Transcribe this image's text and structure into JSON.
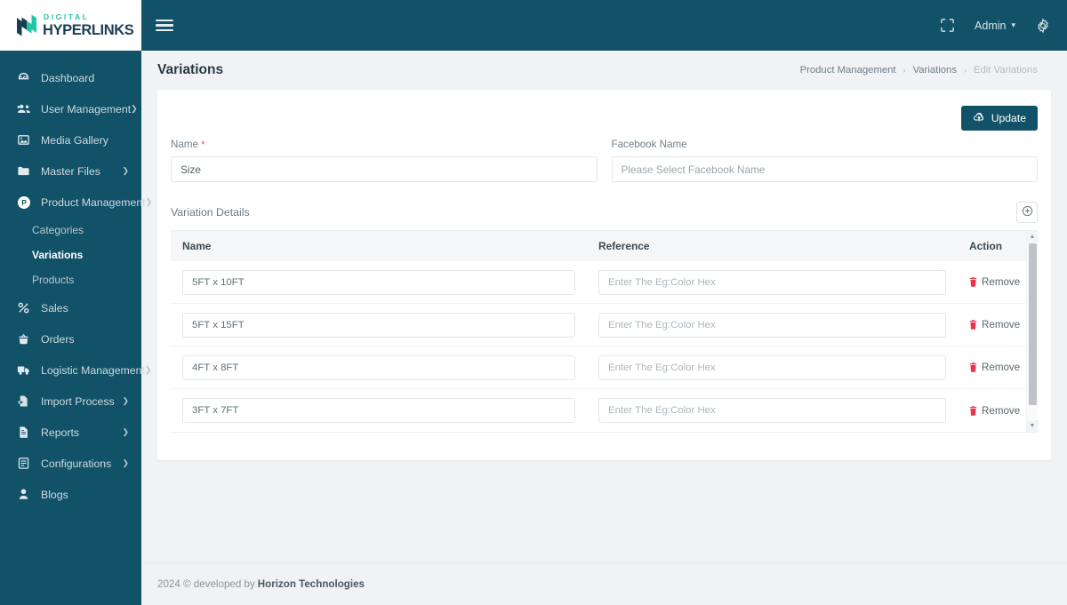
{
  "brand": {
    "top_text": "DIGITAL",
    "bottom_text": "HYPERLINKS",
    "accent": "#20c6a4",
    "dark": "#1b3f52"
  },
  "theme": {
    "sidebar_bg": "#115268",
    "topbar_bg": "#115268",
    "page_bg": "#f0f2f5",
    "primary": "#115268",
    "danger": "#e8344e",
    "required": "#f0536a"
  },
  "topbar": {
    "menu_toggle": "hamburger-menu",
    "fullscreen_label": "fullscreen-icon",
    "admin_label": "Admin",
    "settings_label": "gear-icon"
  },
  "sidebar": {
    "items": [
      {
        "label": "Dashboard",
        "icon": "dashboard-icon",
        "has_caret": false
      },
      {
        "label": "User Management",
        "icon": "users-icon",
        "has_caret": true
      },
      {
        "label": "Media Gallery",
        "icon": "image-icon",
        "has_caret": false
      },
      {
        "label": "Master Files",
        "icon": "folder-icon",
        "has_caret": true
      },
      {
        "label": "Product Management",
        "icon": "product-icon",
        "has_caret": true,
        "expanded": true
      },
      {
        "label": "Sales",
        "icon": "percent-icon",
        "has_caret": false
      },
      {
        "label": "Orders",
        "icon": "basket-icon",
        "has_caret": false
      },
      {
        "label": "Logistic Management",
        "icon": "truck-icon",
        "has_caret": true
      },
      {
        "label": "Import Process",
        "icon": "file-import-icon",
        "has_caret": true
      },
      {
        "label": "Reports",
        "icon": "report-icon",
        "has_caret": true
      },
      {
        "label": "Configurations",
        "icon": "config-icon",
        "has_caret": true
      },
      {
        "label": "Blogs",
        "icon": "blog-icon",
        "has_caret": false
      }
    ],
    "submenu": [
      {
        "label": "Categories",
        "active": false
      },
      {
        "label": "Variations",
        "active": true
      },
      {
        "label": "Products",
        "active": false
      }
    ]
  },
  "page": {
    "title": "Variations",
    "breadcrumb": [
      {
        "label": "Product Management",
        "current": false
      },
      {
        "label": "Variations",
        "current": false
      },
      {
        "label": "Edit Variations",
        "current": true
      }
    ],
    "separator": "›"
  },
  "form": {
    "update_label": "Update",
    "update_icon": "cloud-upload-icon",
    "name": {
      "label": "Name",
      "required_mark": "*",
      "value": "Size",
      "placeholder": ""
    },
    "facebook_name": {
      "label": "Facebook Name",
      "value": "",
      "placeholder": "Please Select Facebook Name"
    }
  },
  "variation_details": {
    "section_title": "Variation Details",
    "add_icon": "plus-circle-icon",
    "columns": [
      "Name",
      "Reference",
      "Action"
    ],
    "reference_placeholder": "Enter The Eg:Color Hex",
    "remove_label": "Remove",
    "remove_icon": "trash-icon",
    "rows": [
      {
        "name": "5FT x 10FT",
        "reference": ""
      },
      {
        "name": "5FT x 15FT",
        "reference": ""
      },
      {
        "name": "4FT x 8FT",
        "reference": ""
      },
      {
        "name": "3FT x 7FT",
        "reference": ""
      }
    ]
  },
  "footer": {
    "prefix": "2024 © developed by",
    "company": "Horizon Technologies"
  }
}
